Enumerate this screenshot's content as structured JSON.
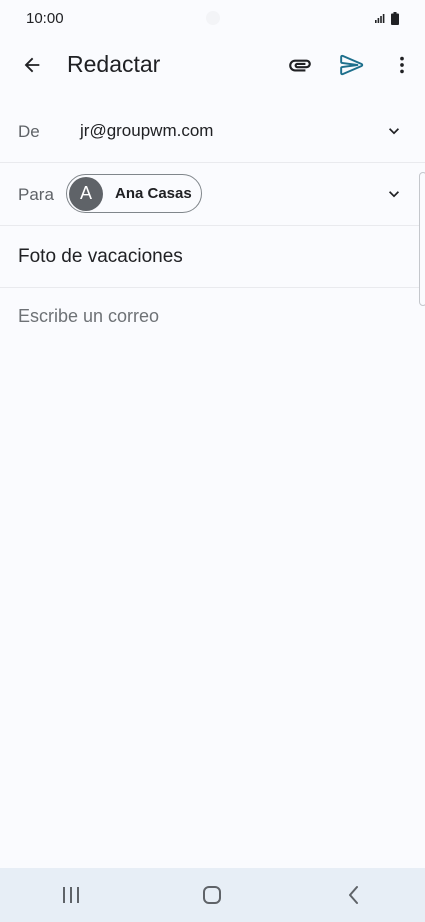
{
  "status_bar": {
    "time": "10:00"
  },
  "app_bar": {
    "title": "Redactar",
    "back_icon": "arrow-back-icon",
    "attach_icon": "paperclip-icon",
    "send_icon": "send-icon",
    "more_icon": "more-vert-icon"
  },
  "compose": {
    "from_label": "De",
    "from_value": "jr@groupwm.com",
    "to_label": "Para",
    "recipient": {
      "initial": "A",
      "name": "Ana Casas"
    },
    "subject": "Foto de vacaciones",
    "body_placeholder": "Escribe un correo"
  },
  "colors": {
    "accent": "#1a73e8",
    "send": "#1d6f8c",
    "background": "#fafbfe",
    "nav_bar": "#e7eef6"
  }
}
